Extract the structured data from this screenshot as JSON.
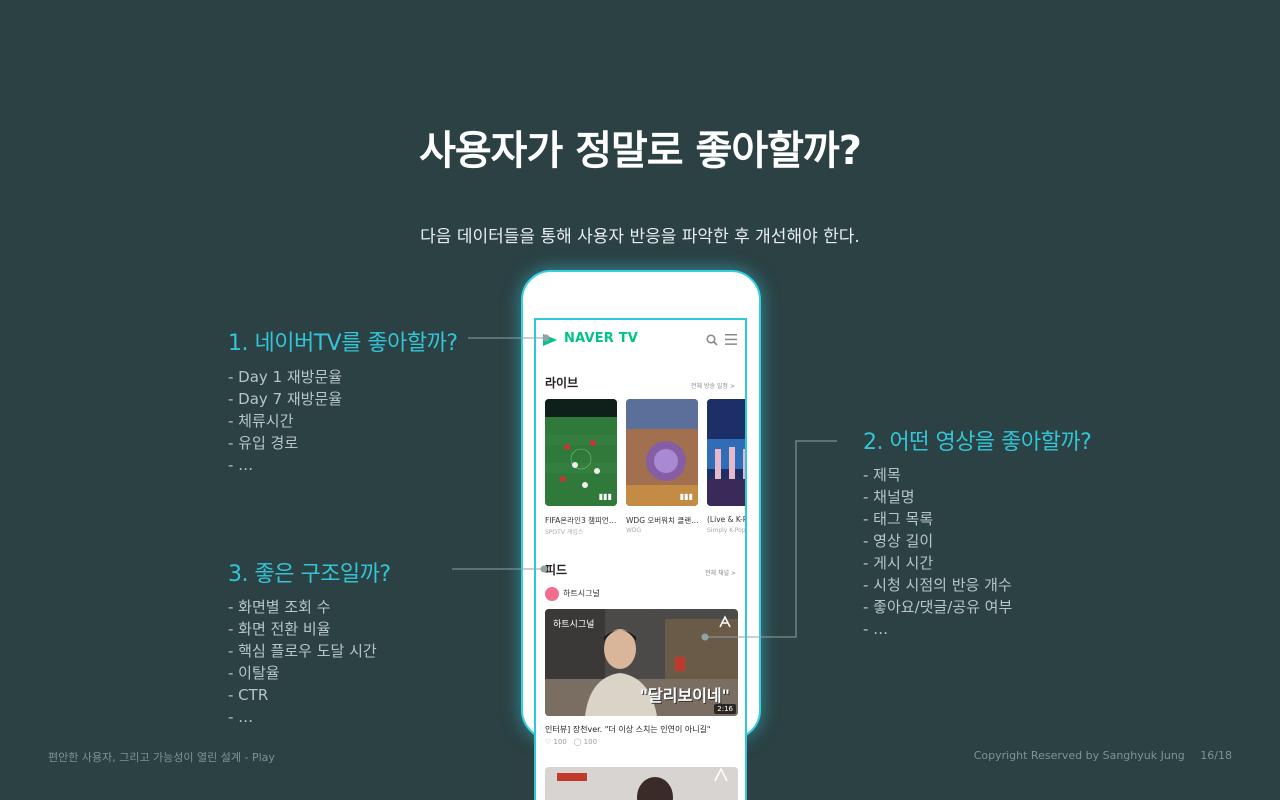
{
  "slide": {
    "title": "사용자가 정말로 좋아할까?",
    "subtitle": "다음 데이터들을 통해 사용자 반응을 파악한 후 개선해야 한다."
  },
  "sections": [
    {
      "title": "1. 네이버TV를 좋아할까?",
      "items": [
        "- Day 1 재방문율",
        "- Day 7 재방문율",
        "- 체류시간",
        "- 유입 경로",
        "- …"
      ]
    },
    {
      "title": "2. 어떤 영상을 좋아할까?",
      "items": [
        "- 제목",
        "- 채널명",
        "- 태그 목록",
        "- 영상 길이",
        "- 게시 시간",
        "- 시청 시점의 반응 개수",
        "- 좋아요/댓글/공유 여부",
        "- …"
      ]
    },
    {
      "title": "3. 좋은 구조일까?",
      "items": [
        "- 화면별 조회 수",
        "- 화면 전환 비율",
        "- 핵심 플로우 도달 시간",
        "- 이탈율",
        "- CTR",
        "- …"
      ]
    }
  ],
  "phone": {
    "logo_text": "NAVER TV",
    "live": {
      "heading": "라이브",
      "link": "전체 방송 일정 >",
      "cards": [
        {
          "title": "FIFA온라인3 챔피언…",
          "sub": "SPOTV 게임스"
        },
        {
          "title": "WDG 오버워치 클랜…",
          "sub": "WDG"
        },
        {
          "title": "(Live & K-Po",
          "sub": "Simply K-Pop"
        }
      ]
    },
    "feed": {
      "heading": "피드",
      "link": "전체 채널 >",
      "channel": "하트시그널",
      "thumb_channel": "하트시그널",
      "thumb_caption": "\"달리보이네\"",
      "duration": "2:16",
      "video_title": "인터뷰] 장천ver. \"더 이상 스치는 인연이 아니길\"",
      "likes": "100",
      "comments": "100"
    }
  },
  "footer": {
    "left": "편안한 사용자, 그리고 가능성이 열린 설계 - Play",
    "copyright": "Copyright Reserved by Sanghyuk Jung",
    "page": "16/18"
  },
  "colors": {
    "background": "#2b4144",
    "accent": "#33c5d6",
    "naver_green": "#00c389"
  }
}
